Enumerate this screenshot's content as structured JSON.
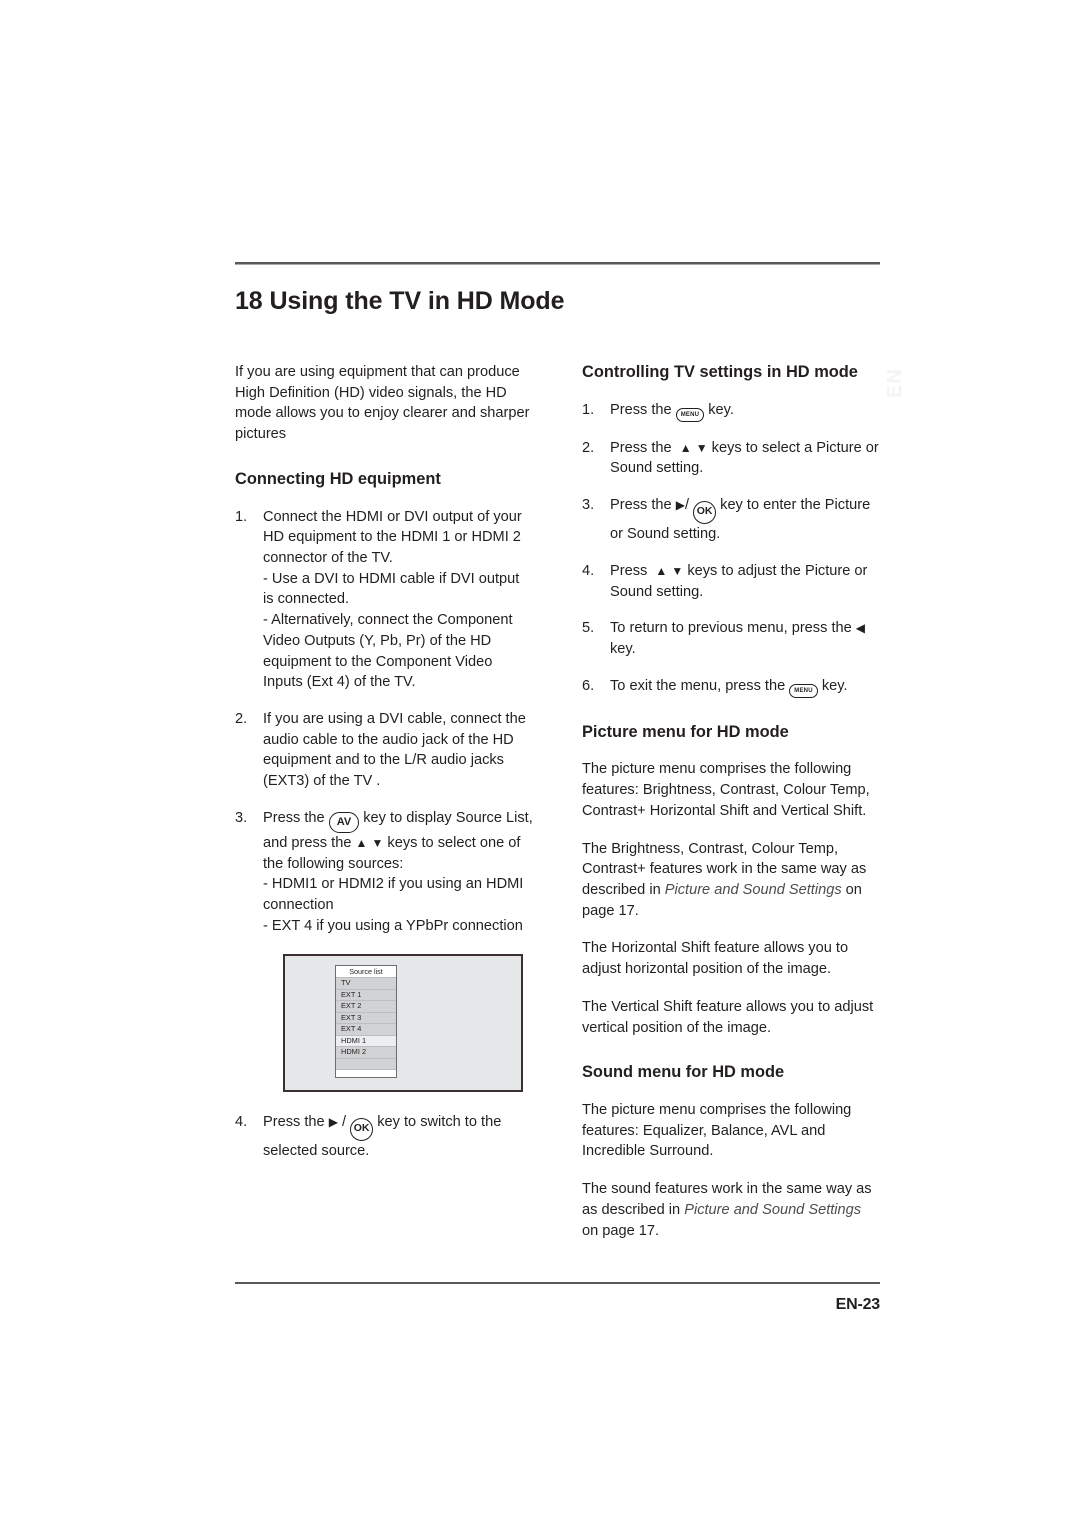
{
  "page": {
    "chapter_title": "18 Using the TV in HD Mode",
    "footer_page_label": "EN-23",
    "watermark_text": "EN"
  },
  "left_column": {
    "intro_paragraph": "If you are using equipment that can produce High Definition (HD) video signals, the HD mode allows you to enjoy clearer and sharper pictures",
    "section_connecting_heading": "Connecting HD equipment",
    "steps": [
      {
        "number": "1.",
        "text": "Connect the HDMI or DVI output of your HD equipment to the HDMI 1 or HDMI 2 connector of the TV.",
        "sub_lines": [
          "- Use a DVI to HDMI cable if DVI output is connected.",
          "- Alternatively,  connect the Component Video Outputs (Y, Pb, Pr) of the HD equipment to the Component Video Inputs (Ext 4) of the TV."
        ]
      },
      {
        "number": "2.",
        "text": "If you are using a DVI cable, connect the audio cable to the audio jack of the HD equipment and to the L/R audio jacks (EXT3) of the TV .",
        "sub_lines": []
      },
      {
        "number": "3.",
        "text_before_key": "Press the",
        "key_label": "AV",
        "text_after_key": "key to display Source List, and press the",
        "arrow_up": "▲",
        "arrow_down": "▼",
        "text_end": "keys to select one of the following sources:",
        "sub_lines": [
          "- HDMI1 or HDMI2 if you using an HDMI connection",
          "- EXT 4 if you using a YPbPr connection"
        ]
      },
      {
        "number": "4.",
        "text_before_arrow": "Press the",
        "arrow_right": "▶",
        "slash": "/",
        "key_label": "OK",
        "text_after_key": "key to switch to the selected source."
      }
    ],
    "figure": {
      "title": "Source list",
      "items": [
        "TV",
        "EXT 1",
        "EXT 2",
        "EXT 3",
        "EXT 4",
        "HDMI 1",
        "HDMI 2"
      ],
      "selected_item": "HDMI 1",
      "screen_bg_color": "#e6e7e8",
      "border_color": "#3b3031",
      "list_bg_color": "#d0d2d3",
      "selected_bg_color": "#edeef0"
    }
  },
  "right_column": {
    "section_controlling_heading": "Controlling TV settings in HD mode",
    "controlling_steps": [
      {
        "number": "1.",
        "text_before_key": "Press the",
        "key_label": "MENU",
        "text_after_key": "key."
      },
      {
        "number": "2.",
        "text_before_arrow": "Press the",
        "arrow_up": "▲",
        "arrow_down": "▼",
        "text_after": "keys to select a Picture or Sound setting."
      },
      {
        "number": "3.",
        "text_before_arrow": "Press the",
        "arrow_right": "▶",
        "slash": "/",
        "key_label": "OK",
        "text_after_key": "key to enter the Picture or Sound setting."
      },
      {
        "number": "4.",
        "text_before_arrow": "Press",
        "arrow_up": "▲",
        "arrow_down": "▼",
        "text_after": "keys to adjust the Picture or Sound setting."
      },
      {
        "number": "5.",
        "text_before_arrow": "To return to previous menu, press the",
        "arrow_left": "◀",
        "text_after": "key."
      },
      {
        "number": "6.",
        "text_before_key": "To exit the menu, press the",
        "key_label": "MENU",
        "text_after_key": "key."
      }
    ],
    "section_picture_heading": "Picture menu for HD mode",
    "picture_paragraph_1": "The picture menu comprises the following features: Brightness, Contrast, Colour Temp, Contrast+ Horizontal Shift and Vertical Shift.",
    "picture_paragraph_2_part1": "The Brightness, Contrast, Colour Temp, Contrast+ features work in the same way as described in ",
    "picture_paragraph_2_italic": "Picture and Sound Settings",
    "picture_paragraph_2_part2": " on page 17.",
    "picture_paragraph_3": "The Horizontal Shift feature allows you to adjust horizontal position of the image.",
    "picture_paragraph_4": "The Vertical Shift feature allows you to adjust vertical position of the image.",
    "section_sound_heading": "Sound menu for HD mode",
    "sound_paragraph_1": "The picture menu comprises the following features: Equalizer, Balance, AVL and Incredible Surround.",
    "sound_paragraph_2_part1": "The sound features work in the same way as as described in ",
    "sound_paragraph_2_italic": "Picture and Sound Settings",
    "sound_paragraph_2_part2": " on page 17."
  }
}
